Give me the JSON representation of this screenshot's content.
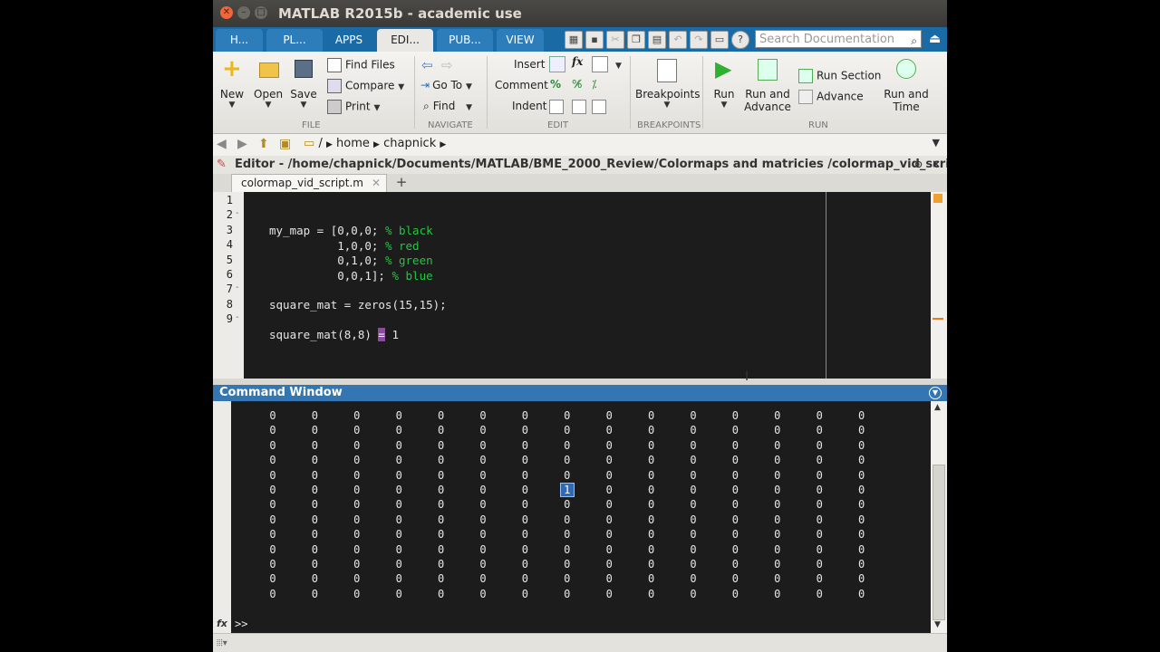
{
  "window": {
    "title": "MATLAB R2015b - academic use"
  },
  "tabs": [
    {
      "label": "H..."
    },
    {
      "label": "PL..."
    },
    {
      "label": "APPS"
    },
    {
      "label": "EDI..."
    },
    {
      "label": "PUB..."
    },
    {
      "label": "VIEW"
    }
  ],
  "search": {
    "placeholder": "Search Documentation"
  },
  "ribbon": {
    "file": {
      "group": "FILE",
      "new": "New",
      "open": "Open",
      "save": "Save",
      "find_files": "Find Files",
      "compare": "Compare",
      "print": "Print"
    },
    "navigate": {
      "group": "NAVIGATE",
      "go_to": "Go To",
      "find": "Find"
    },
    "edit": {
      "group": "EDIT",
      "insert": "Insert",
      "comment": "Comment",
      "indent": "Indent",
      "fx": "fx"
    },
    "breakpoints": {
      "group": "BREAKPOINTS",
      "label": "Breakpoints"
    },
    "run": {
      "group": "RUN",
      "run": "Run",
      "run_and_advance_1": "Run and",
      "run_and_advance_2": "Advance",
      "run_section": "Run Section",
      "advance": "Advance",
      "run_and_time_1": "Run and",
      "run_and_time_2": "Time"
    }
  },
  "address": {
    "root": "/",
    "seg1": "home",
    "seg2": "chapnick"
  },
  "editor": {
    "title": "Editor - /home/chapnick/Documents/MATLAB/BME_2000_Review/Colormaps and matricies /colormap_vid_scrip...",
    "file_tab": "colormap_vid_script.m",
    "lines": [
      {
        "n": "1",
        "code": "",
        "comment": "",
        "mark": ""
      },
      {
        "n": "2",
        "code": "my_map = [0,0,0; ",
        "comment": "% black",
        "mark": "-"
      },
      {
        "n": "3",
        "code": "          1,0,0; ",
        "comment": "% red",
        "mark": ""
      },
      {
        "n": "4",
        "code": "          0,1,0; ",
        "comment": "% green",
        "mark": ""
      },
      {
        "n": "5",
        "code": "          0,0,1]; ",
        "comment": "% blue",
        "mark": ""
      },
      {
        "n": "6",
        "code": "",
        "comment": "",
        "mark": ""
      },
      {
        "n": "7",
        "code": "square_mat = zeros(15,15);",
        "comment": "",
        "mark": "-"
      },
      {
        "n": "8",
        "code": "",
        "comment": "",
        "mark": ""
      },
      {
        "n": "9",
        "code": "square_mat(8,8) ",
        "hl": "=",
        "after": " 1",
        "comment": "",
        "mark": "-"
      }
    ]
  },
  "command_window": {
    "title": "Command Window",
    "prompt": ">>",
    "fx": "fx",
    "selected_value": "1",
    "zero": "0",
    "rows": 13,
    "cols": 15,
    "selected_row": 5,
    "selected_col": 7
  }
}
